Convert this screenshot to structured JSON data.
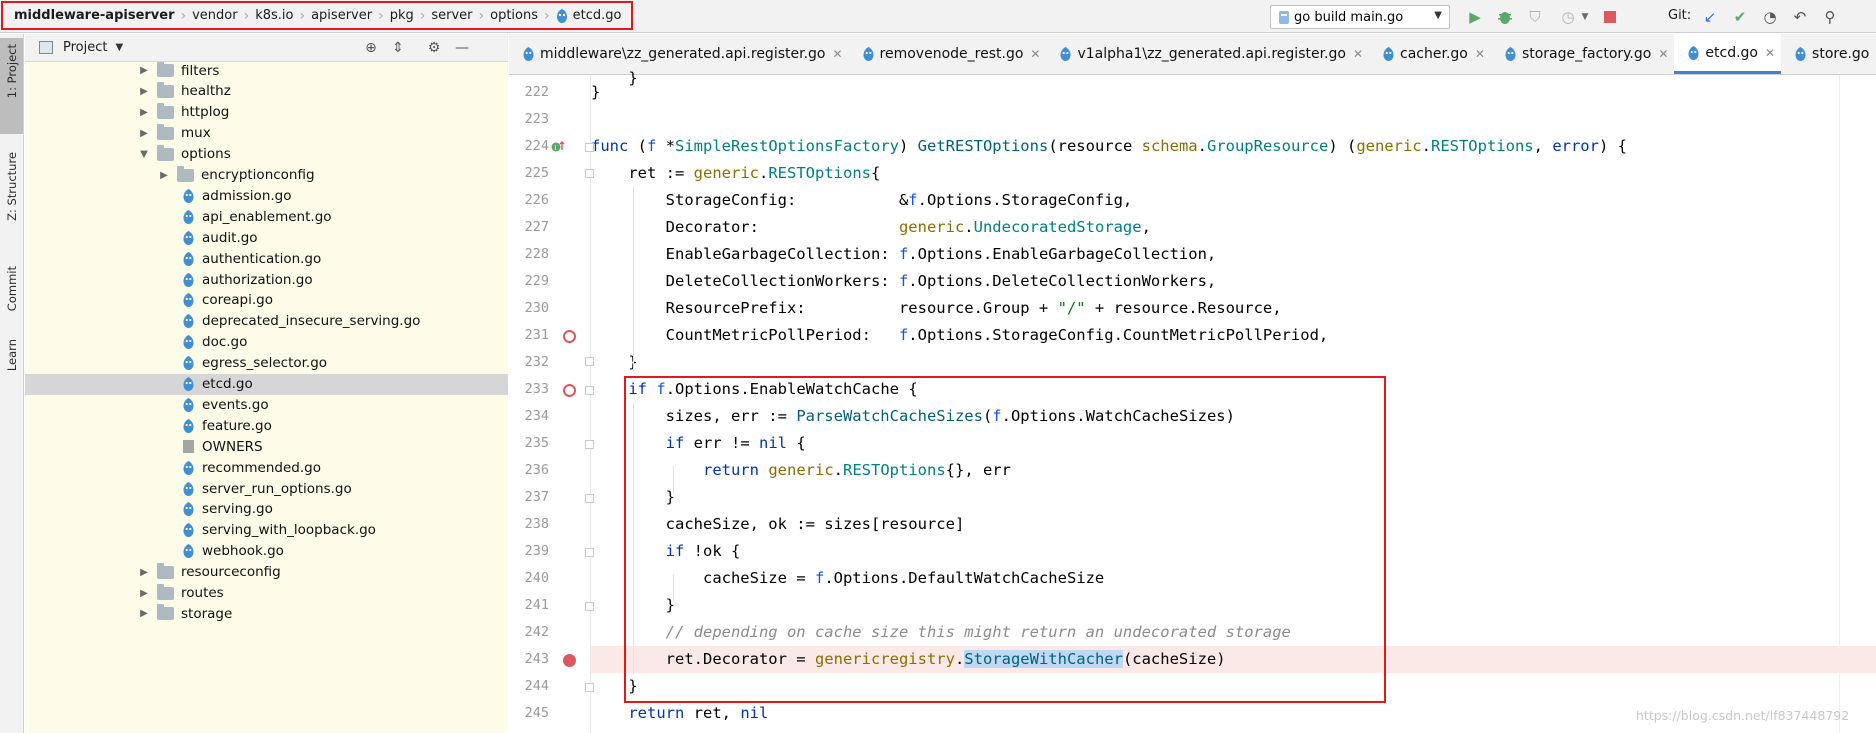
{
  "breadcrumb": {
    "items": [
      "middleware-apiserver",
      "vendor",
      "k8s.io",
      "apiserver",
      "pkg",
      "server",
      "options",
      "etcd.go"
    ]
  },
  "toolbar": {
    "run_config": "go build main.go",
    "git_label": "Git:"
  },
  "side_stripe": {
    "project": "1: Project",
    "structure": "Z: Structure",
    "commit": "Commit",
    "learn": "Learn"
  },
  "project_panel": {
    "title": "Project",
    "tree": [
      {
        "name": "filters",
        "kind": "folder",
        "expanded": false
      },
      {
        "name": "healthz",
        "kind": "folder",
        "expanded": false
      },
      {
        "name": "httplog",
        "kind": "folder",
        "expanded": false
      },
      {
        "name": "mux",
        "kind": "folder",
        "expanded": false
      },
      {
        "name": "options",
        "kind": "folder",
        "expanded": true
      },
      {
        "name": "encryptionconfig",
        "kind": "folder",
        "expanded": false
      },
      {
        "name": "admission.go",
        "kind": "go"
      },
      {
        "name": "api_enablement.go",
        "kind": "go"
      },
      {
        "name": "audit.go",
        "kind": "go"
      },
      {
        "name": "authentication.go",
        "kind": "go"
      },
      {
        "name": "authorization.go",
        "kind": "go"
      },
      {
        "name": "coreapi.go",
        "kind": "go"
      },
      {
        "name": "deprecated_insecure_serving.go",
        "kind": "go"
      },
      {
        "name": "doc.go",
        "kind": "go"
      },
      {
        "name": "egress_selector.go",
        "kind": "go"
      },
      {
        "name": "etcd.go",
        "kind": "go",
        "selected": true
      },
      {
        "name": "events.go",
        "kind": "go"
      },
      {
        "name": "feature.go",
        "kind": "go"
      },
      {
        "name": "OWNERS",
        "kind": "text"
      },
      {
        "name": "recommended.go",
        "kind": "go"
      },
      {
        "name": "server_run_options.go",
        "kind": "go"
      },
      {
        "name": "serving.go",
        "kind": "go"
      },
      {
        "name": "serving_with_loopback.go",
        "kind": "go"
      },
      {
        "name": "webhook.go",
        "kind": "go"
      },
      {
        "name": "resourceconfig",
        "kind": "folder",
        "expanded": false
      },
      {
        "name": "routes",
        "kind": "folder",
        "expanded": false
      },
      {
        "name": "storage",
        "kind": "folder",
        "expanded": false
      }
    ]
  },
  "tabs": [
    {
      "label": "middleware\\zz_generated.api.register.go",
      "active": false
    },
    {
      "label": "removenode_rest.go",
      "active": false
    },
    {
      "label": "v1alpha1\\zz_generated.api.register.go",
      "active": false
    },
    {
      "label": "cacher.go",
      "active": false
    },
    {
      "label": "storage_factory.go",
      "active": false
    },
    {
      "label": "etcd.go",
      "active": true
    },
    {
      "label": "store.go",
      "active": false
    }
  ],
  "editor": {
    "line_numbers": [
      "222",
      "223",
      "224",
      "225",
      "226",
      "227",
      "228",
      "229",
      "230",
      "231",
      "232",
      "233",
      "234",
      "235",
      "236",
      "237",
      "238",
      "239",
      "240",
      "241",
      "242",
      "243",
      "244",
      "245"
    ],
    "breakpoint_lines": [
      "231",
      "233"
    ],
    "active_breakpoint_line": "243"
  },
  "watermark": "https://blog.csdn.net/lf837448792"
}
